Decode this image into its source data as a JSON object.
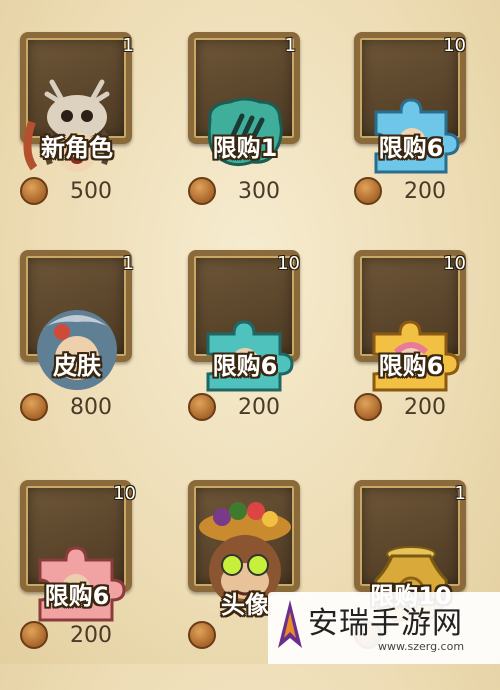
{
  "items": [
    {
      "name": "新角色",
      "count": "1",
      "price": "500",
      "icon": "new-character-tribal-warrior"
    },
    {
      "name": "限购1",
      "count": "1",
      "price": "300",
      "icon": "claw-shard"
    },
    {
      "name": "限购6",
      "count": "10",
      "price": "200",
      "icon": "puzzle-piece-blue"
    },
    {
      "name": "皮肤",
      "count": "1",
      "price": "800",
      "icon": "skin-character-portrait"
    },
    {
      "name": "限购6",
      "count": "10",
      "price": "200",
      "icon": "puzzle-piece-teal"
    },
    {
      "name": "限购6",
      "count": "10",
      "price": "200",
      "icon": "puzzle-piece-gold"
    },
    {
      "name": "限购6",
      "count": "10",
      "price": "200",
      "icon": "puzzle-piece-pink"
    },
    {
      "name": "头像",
      "count": "",
      "price": "",
      "icon": "monkey-avatar"
    },
    {
      "name": "限购10",
      "count": "1",
      "price": "",
      "icon": "golden-vase"
    }
  ],
  "currency_icon": "bronze-coin-icon",
  "watermark": {
    "text": "安瑞手游网",
    "url": "www.szerg.com"
  }
}
